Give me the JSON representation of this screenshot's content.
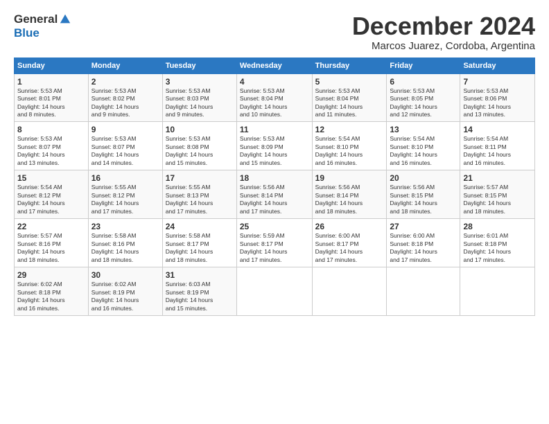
{
  "logo": {
    "general": "General",
    "blue": "Blue"
  },
  "title": {
    "month": "December 2024",
    "location": "Marcos Juarez, Cordoba, Argentina"
  },
  "headers": [
    "Sunday",
    "Monday",
    "Tuesday",
    "Wednesday",
    "Thursday",
    "Friday",
    "Saturday"
  ],
  "weeks": [
    [
      {
        "day": "1",
        "info": "Sunrise: 5:53 AM\nSunset: 8:01 PM\nDaylight: 14 hours\nand 8 minutes."
      },
      {
        "day": "2",
        "info": "Sunrise: 5:53 AM\nSunset: 8:02 PM\nDaylight: 14 hours\nand 9 minutes."
      },
      {
        "day": "3",
        "info": "Sunrise: 5:53 AM\nSunset: 8:03 PM\nDaylight: 14 hours\nand 9 minutes."
      },
      {
        "day": "4",
        "info": "Sunrise: 5:53 AM\nSunset: 8:04 PM\nDaylight: 14 hours\nand 10 minutes."
      },
      {
        "day": "5",
        "info": "Sunrise: 5:53 AM\nSunset: 8:04 PM\nDaylight: 14 hours\nand 11 minutes."
      },
      {
        "day": "6",
        "info": "Sunrise: 5:53 AM\nSunset: 8:05 PM\nDaylight: 14 hours\nand 12 minutes."
      },
      {
        "day": "7",
        "info": "Sunrise: 5:53 AM\nSunset: 8:06 PM\nDaylight: 14 hours\nand 13 minutes."
      }
    ],
    [
      {
        "day": "8",
        "info": "Sunrise: 5:53 AM\nSunset: 8:07 PM\nDaylight: 14 hours\nand 13 minutes."
      },
      {
        "day": "9",
        "info": "Sunrise: 5:53 AM\nSunset: 8:07 PM\nDaylight: 14 hours\nand 14 minutes."
      },
      {
        "day": "10",
        "info": "Sunrise: 5:53 AM\nSunset: 8:08 PM\nDaylight: 14 hours\nand 15 minutes."
      },
      {
        "day": "11",
        "info": "Sunrise: 5:53 AM\nSunset: 8:09 PM\nDaylight: 14 hours\nand 15 minutes."
      },
      {
        "day": "12",
        "info": "Sunrise: 5:54 AM\nSunset: 8:10 PM\nDaylight: 14 hours\nand 16 minutes."
      },
      {
        "day": "13",
        "info": "Sunrise: 5:54 AM\nSunset: 8:10 PM\nDaylight: 14 hours\nand 16 minutes."
      },
      {
        "day": "14",
        "info": "Sunrise: 5:54 AM\nSunset: 8:11 PM\nDaylight: 14 hours\nand 16 minutes."
      }
    ],
    [
      {
        "day": "15",
        "info": "Sunrise: 5:54 AM\nSunset: 8:12 PM\nDaylight: 14 hours\nand 17 minutes."
      },
      {
        "day": "16",
        "info": "Sunrise: 5:55 AM\nSunset: 8:12 PM\nDaylight: 14 hours\nand 17 minutes."
      },
      {
        "day": "17",
        "info": "Sunrise: 5:55 AM\nSunset: 8:13 PM\nDaylight: 14 hours\nand 17 minutes."
      },
      {
        "day": "18",
        "info": "Sunrise: 5:56 AM\nSunset: 8:14 PM\nDaylight: 14 hours\nand 17 minutes."
      },
      {
        "day": "19",
        "info": "Sunrise: 5:56 AM\nSunset: 8:14 PM\nDaylight: 14 hours\nand 18 minutes."
      },
      {
        "day": "20",
        "info": "Sunrise: 5:56 AM\nSunset: 8:15 PM\nDaylight: 14 hours\nand 18 minutes."
      },
      {
        "day": "21",
        "info": "Sunrise: 5:57 AM\nSunset: 8:15 PM\nDaylight: 14 hours\nand 18 minutes."
      }
    ],
    [
      {
        "day": "22",
        "info": "Sunrise: 5:57 AM\nSunset: 8:16 PM\nDaylight: 14 hours\nand 18 minutes."
      },
      {
        "day": "23",
        "info": "Sunrise: 5:58 AM\nSunset: 8:16 PM\nDaylight: 14 hours\nand 18 minutes."
      },
      {
        "day": "24",
        "info": "Sunrise: 5:58 AM\nSunset: 8:17 PM\nDaylight: 14 hours\nand 18 minutes."
      },
      {
        "day": "25",
        "info": "Sunrise: 5:59 AM\nSunset: 8:17 PM\nDaylight: 14 hours\nand 17 minutes."
      },
      {
        "day": "26",
        "info": "Sunrise: 6:00 AM\nSunset: 8:17 PM\nDaylight: 14 hours\nand 17 minutes."
      },
      {
        "day": "27",
        "info": "Sunrise: 6:00 AM\nSunset: 8:18 PM\nDaylight: 14 hours\nand 17 minutes."
      },
      {
        "day": "28",
        "info": "Sunrise: 6:01 AM\nSunset: 8:18 PM\nDaylight: 14 hours\nand 17 minutes."
      }
    ],
    [
      {
        "day": "29",
        "info": "Sunrise: 6:02 AM\nSunset: 8:18 PM\nDaylight: 14 hours\nand 16 minutes."
      },
      {
        "day": "30",
        "info": "Sunrise: 6:02 AM\nSunset: 8:19 PM\nDaylight: 14 hours\nand 16 minutes."
      },
      {
        "day": "31",
        "info": "Sunrise: 6:03 AM\nSunset: 8:19 PM\nDaylight: 14 hours\nand 15 minutes."
      },
      {
        "day": "",
        "info": ""
      },
      {
        "day": "",
        "info": ""
      },
      {
        "day": "",
        "info": ""
      },
      {
        "day": "",
        "info": ""
      }
    ]
  ]
}
